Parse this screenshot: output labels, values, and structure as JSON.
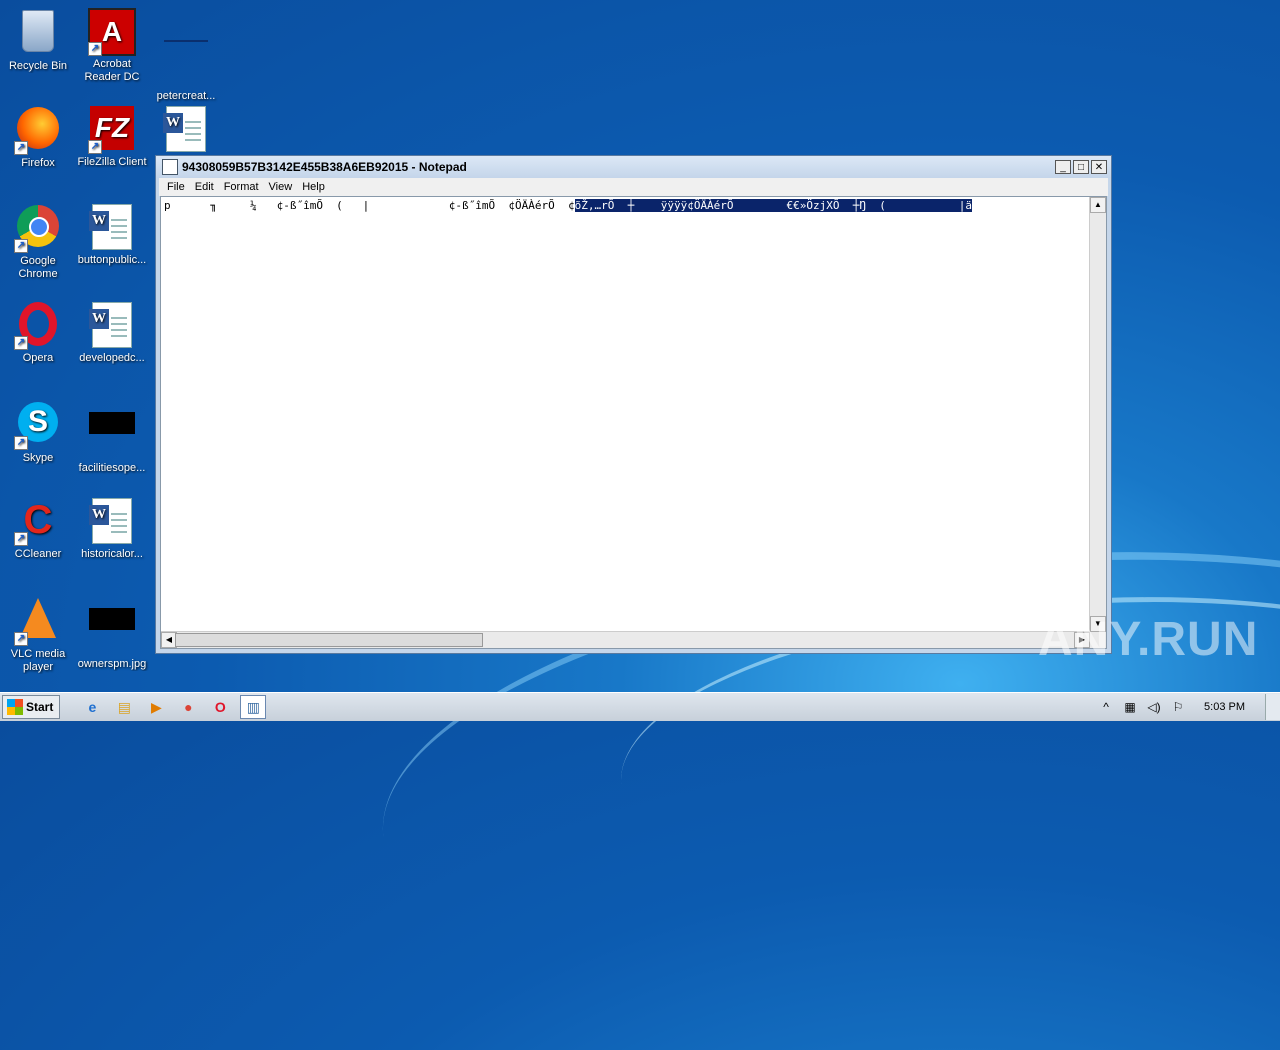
{
  "desktop": {
    "icons": [
      {
        "label": "Recycle Bin",
        "icon": "recycle-bin-icon"
      },
      {
        "label": "Acrobat Reader DC",
        "icon": "acrobat-icon"
      },
      {
        "label": "petercreat...",
        "icon": "file-icon"
      },
      {
        "label": "Firefox",
        "icon": "firefox-icon"
      },
      {
        "label": "FileZilla Client",
        "icon": "filezilla-icon"
      },
      {
        "label": "",
        "icon": "word-doc-icon"
      },
      {
        "label": "Google Chrome",
        "icon": "chrome-icon"
      },
      {
        "label": "buttonpublic...",
        "icon": "word-doc-icon"
      },
      {
        "label": "Opera",
        "icon": "opera-icon"
      },
      {
        "label": "developedc...",
        "icon": "word-doc-icon"
      },
      {
        "label": "Skype",
        "icon": "skype-icon"
      },
      {
        "label": "facilitiesope...",
        "icon": "image-icon"
      },
      {
        "label": "CCleaner",
        "icon": "ccleaner-icon"
      },
      {
        "label": "historicalor...",
        "icon": "word-doc-icon"
      },
      {
        "label": "VLC media player",
        "icon": "vlc-icon"
      },
      {
        "label": "ownerspm.jpg",
        "icon": "image-icon"
      }
    ]
  },
  "notepad": {
    "title": "94308059B57B3142E455B38A6EB92015 - Notepad",
    "menu": [
      "File",
      "Edit",
      "Format",
      "View",
      "Help"
    ],
    "text_unselected": "p      ╖     ¼   ¢-ß˝îmÕ  (   |            ¢-ß˝îmÕ  ¢ÖÄÀérÕ  ¢",
    "text_selected": "õŽ,…rÕ  ┼    ÿÿÿÿ¢ÖÄÀérÕ        €€»ÖzjXÕ  ┼Ŋ  (           |ä",
    "window_buttons": {
      "minimize": "_",
      "maximize": "□",
      "close": "✕"
    }
  },
  "watermark": "ANY.RUN",
  "taskbar": {
    "start_label": "Start",
    "pinned": [
      {
        "name": "internet-explorer",
        "glyph": "e"
      },
      {
        "name": "explorer",
        "glyph": "▤"
      },
      {
        "name": "media-player",
        "glyph": "▶"
      },
      {
        "name": "chrome",
        "glyph": "●"
      },
      {
        "name": "opera",
        "glyph": "O"
      },
      {
        "name": "notepad",
        "glyph": "▥"
      }
    ],
    "clock": "5:03 PM"
  }
}
